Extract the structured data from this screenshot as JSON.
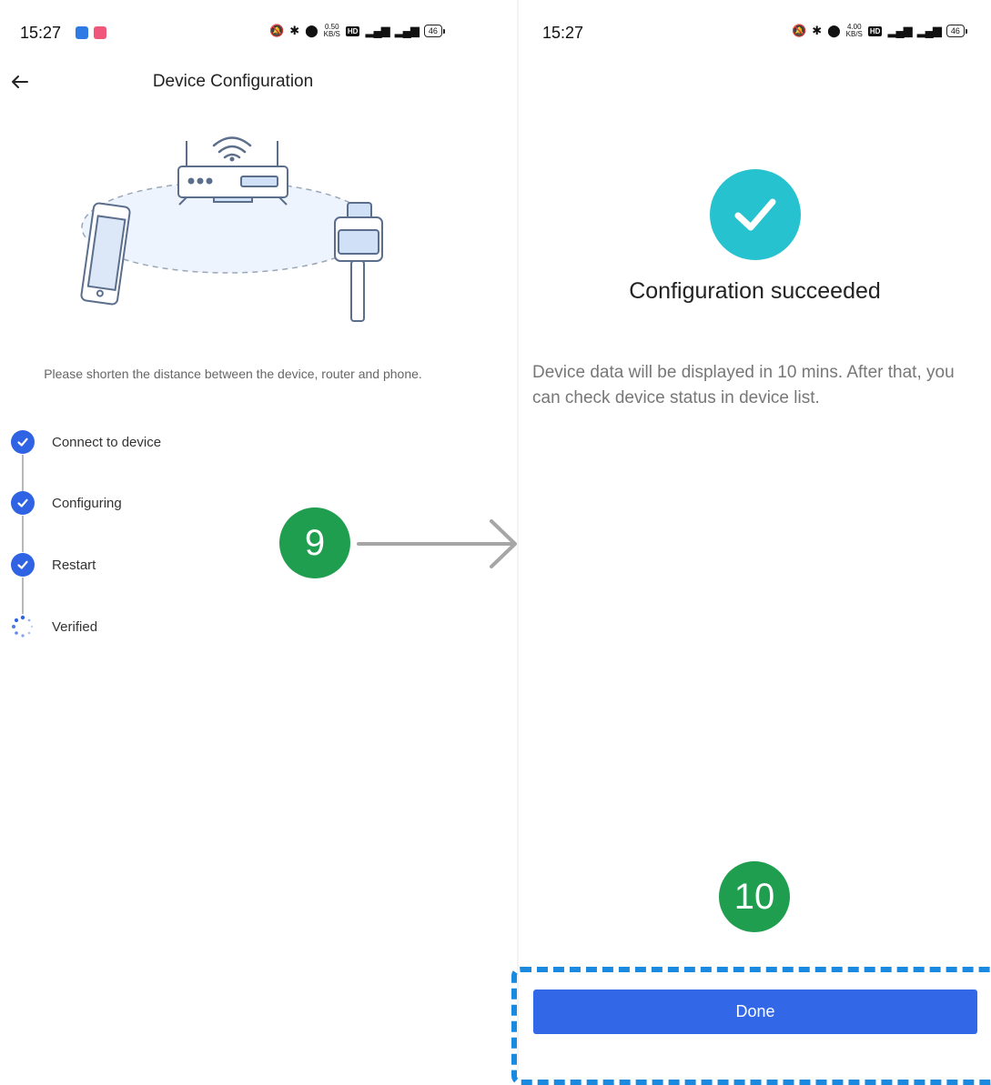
{
  "left_screen": {
    "status_bar": {
      "time": "15:27",
      "speed_top": "0.50",
      "speed_unit": "KB/S",
      "battery": "46"
    },
    "header": {
      "title": "Device Configuration"
    },
    "hint": "Please shorten the distance between the device, router and phone.",
    "steps": [
      {
        "label": "Connect to device",
        "state": "done"
      },
      {
        "label": "Configuring",
        "state": "done"
      },
      {
        "label": "Restart",
        "state": "done"
      },
      {
        "label": "Verified",
        "state": "loading"
      }
    ]
  },
  "right_screen": {
    "status_bar": {
      "time": "15:27",
      "speed_top": "4.00",
      "speed_unit": "KB/S",
      "battery": "46"
    },
    "title": "Configuration succeeded",
    "description": "Device data will be displayed in 10 mins. After that, you can check device status in device list.",
    "done_label": "Done"
  },
  "annotations": {
    "step_9": "9",
    "step_10": "10"
  },
  "colors": {
    "primary": "#3267e8",
    "success": "#27c2cf",
    "badge": "#1e9e4e",
    "highlight": "#1a8ae0"
  }
}
